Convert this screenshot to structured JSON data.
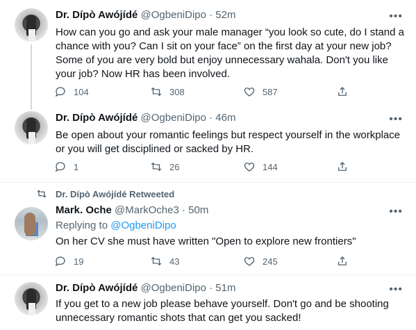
{
  "tweets": [
    {
      "name": "Dr. Dípò Awójídé",
      "handle": "@OgbeniDipo · 52m",
      "text": "How can you go and ask your male manager “you look so cute, do I stand a chance with you? Can I sit on your face” on the first day at your new job? Some of you are very bold but enjoy unnecessary wahala. Don't you like your job? Now HR has been involved.",
      "replies": "104",
      "retweets": "308",
      "likes": "587"
    },
    {
      "name": "Dr. Dípò Awójídé",
      "handle": "@OgbeniDipo · 46m",
      "text": "Be open about your romantic feelings but respect yourself in the workplace or you will get disciplined or sacked by HR.",
      "replies": "1",
      "retweets": "26",
      "likes": "144"
    },
    {
      "retweeted_by": "Dr. Dípò Awójídé Retweeted",
      "name": "Mark. Oche",
      "handle": "@MarkOche3 · 50m",
      "replying_label": "Replying to",
      "replying_handle": "@OgbeniDipo",
      "text": "On her CV she must have written \"Open to explore new frontiers\"",
      "replies": "19",
      "retweets": "43",
      "likes": "245"
    },
    {
      "name": "Dr. Dípò Awójídé",
      "handle": "@OgbeniDipo · 51m",
      "text": "If you get to a new job please behave yourself. Don't go and be shooting unnecessary romantic shots that can get you sacked!"
    }
  ],
  "more_label": "•••",
  "colors": {
    "text": "#0f1419",
    "muted": "#536471",
    "link": "#1d9bf0",
    "divider": "#eff3f4"
  }
}
